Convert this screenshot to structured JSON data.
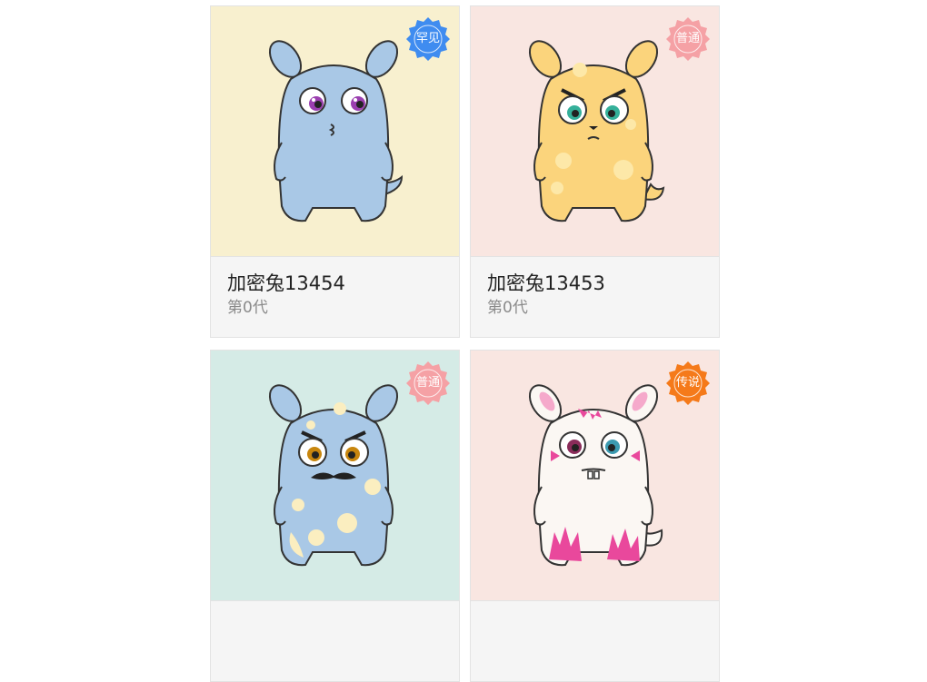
{
  "cards": [
    {
      "name": "加密兔13454",
      "generation": "第0代",
      "rarity": "罕见",
      "bg": "#f8f0cf",
      "badge": "#3f8cf0",
      "body": "#a9c8e6",
      "spots": "",
      "tail": "#a9c8e6"
    },
    {
      "name": "加密兔13453",
      "generation": "第0代",
      "rarity": "普通",
      "bg": "#f9e6e1",
      "badge": "#f5a1a5",
      "body": "#fbd47c",
      "spots": "#fde8a8",
      "tail": "#fbd47c"
    },
    {
      "name": "",
      "generation": "",
      "rarity": "普通",
      "bg": "#d5ebe6",
      "badge": "#f5a1a5",
      "body": "#a9c8e6",
      "spots": "#fbeec0",
      "tail": "#a9c8e6"
    },
    {
      "name": "",
      "generation": "",
      "rarity": "传说",
      "bg": "#f9e6e1",
      "badge": "#f57a1a",
      "body": "#fbf7f3",
      "spots": "#e9489c",
      "tail": "#fbf7f3"
    }
  ]
}
